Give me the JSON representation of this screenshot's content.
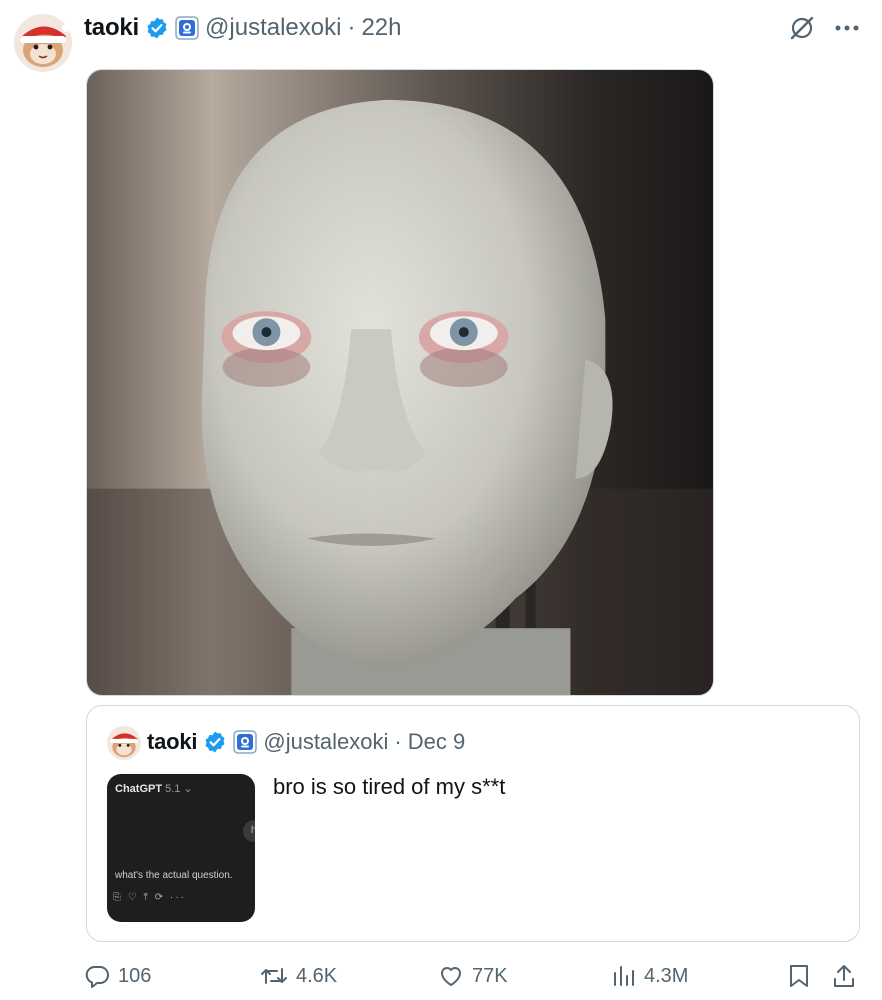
{
  "tweet": {
    "author_name": "taoki",
    "handle": "@justalexoki",
    "separator": "·",
    "time": "22h",
    "avatar_icon": "santa-character-avatar",
    "verified_icon": "verified-badge-icon",
    "affiliation_icon": "affiliate-badge-icon"
  },
  "header_actions": {
    "grok_icon": "grok-icon",
    "more_icon": "more-dots-icon"
  },
  "media": {
    "icon": "robot-face-image"
  },
  "quote": {
    "author_name": "taoki",
    "handle": "@justalexoki",
    "separator": "·",
    "time": "Dec 9",
    "text": "bro is so tired of my s**t",
    "thumbnail": {
      "title": "ChatGPT",
      "version": "5.1",
      "pill_text": "he",
      "answer": "what's the actual question.",
      "icons": "⎘ ♡ ⤒ ⟳ ···"
    }
  },
  "actions": {
    "replies": "106",
    "reposts": "4.6K",
    "likes": "77K",
    "views": "4.3M"
  },
  "colors": {
    "verified": "#1d9bf0",
    "secondary_text": "#536471",
    "border": "#cfd9de"
  }
}
